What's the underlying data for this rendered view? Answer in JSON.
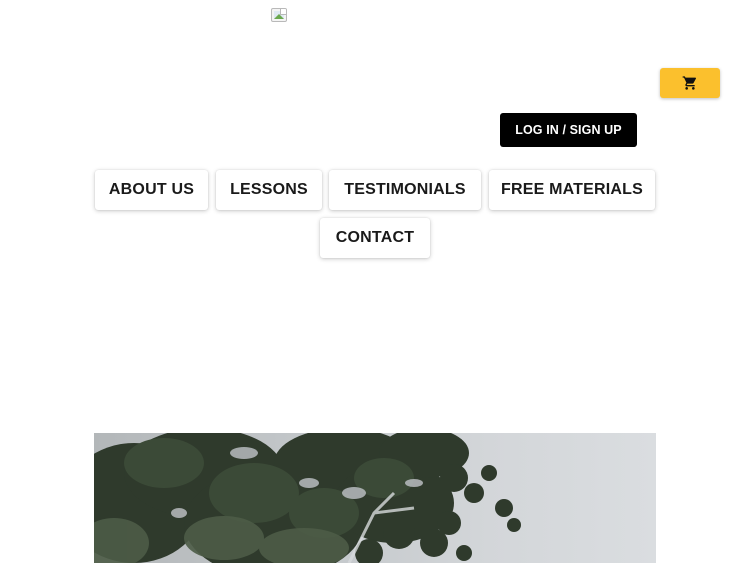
{
  "header": {
    "logo_icon": "broken-image-icon",
    "cart_icon": "shopping-cart-icon",
    "login_label": "LOG IN / SIGN UP"
  },
  "nav": {
    "items": [
      {
        "label": "ABOUT US"
      },
      {
        "label": "LESSONS"
      },
      {
        "label": "TESTIMONIALS"
      },
      {
        "label": "FREE MATERIALS"
      },
      {
        "label": "CONTACT"
      }
    ]
  },
  "hero": {
    "image": "tree-canopy-photo"
  },
  "colors": {
    "cart_button": "#fbc02d",
    "login_button": "#000000",
    "nav_text": "#1a1a1a",
    "background": "#ffffff"
  }
}
